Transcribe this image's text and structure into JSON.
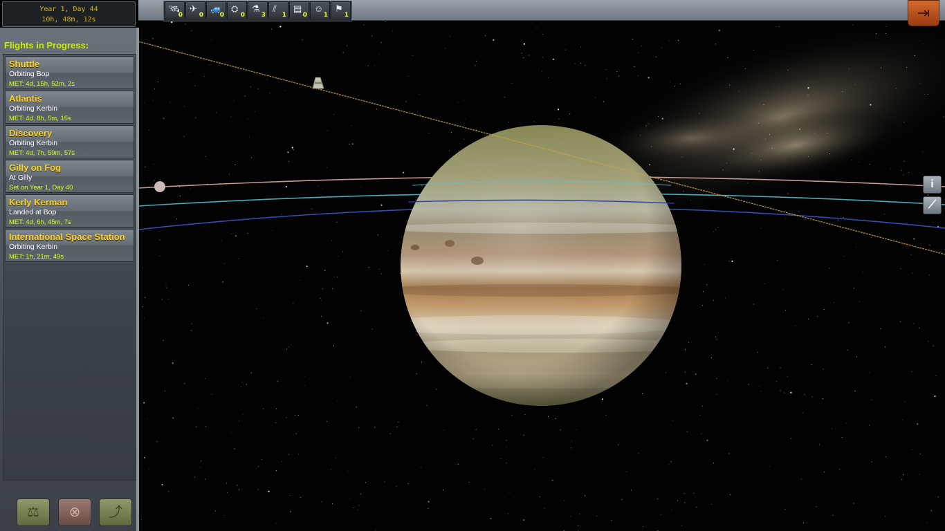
{
  "clock": {
    "date": "Year 1, Day 44",
    "time": "10h, 48m, 12s"
  },
  "filters": [
    {
      "icon": "probe-icon",
      "glyph": "🛰",
      "count": "0"
    },
    {
      "icon": "ship-icon",
      "glyph": "✈",
      "count": "0"
    },
    {
      "icon": "rover-icon",
      "glyph": "🚙",
      "count": "0"
    },
    {
      "icon": "lander-icon",
      "glyph": "⛭",
      "count": "0"
    },
    {
      "icon": "science-icon",
      "glyph": "⚗",
      "count": "3"
    },
    {
      "icon": "debris-icon",
      "glyph": "⫽",
      "count": "1"
    },
    {
      "icon": "base-icon",
      "glyph": "▤",
      "count": "0"
    },
    {
      "icon": "eva-icon",
      "glyph": "☺",
      "count": "1"
    },
    {
      "icon": "flag-icon",
      "glyph": "⚑",
      "count": "1"
    }
  ],
  "sidebar": {
    "title": "Flights in Progress:",
    "flights": [
      {
        "name": "Shuttle",
        "status": "Orbiting Bop",
        "met": "MET: 4d, 15h, 52m, 2s"
      },
      {
        "name": "Atlantis",
        "status": "Orbiting Kerbin",
        "met": "MET: 4d, 8h, 5m, 15s"
      },
      {
        "name": "Discovery",
        "status": "Orbiting Kerbin",
        "met": "MET: 4d, 7h, 59m, 57s"
      },
      {
        "name": "Gilly on Fog",
        "status": "At Gilly",
        "met": "Set on Year 1, Day 40"
      },
      {
        "name": "Kerly Kerman",
        "status": "Landed at Bop",
        "met": "MET: 4d, 6h, 45m, 7s"
      },
      {
        "name": "International Space Station",
        "status": "Orbiting Kerbin",
        "met": "MET: 1h, 21m, 49s"
      }
    ]
  },
  "buttons": {
    "edit": "⚖",
    "terminate": "⊗",
    "recover": "⤴"
  },
  "tools": {
    "info": "i",
    "orbit": "⟋"
  },
  "exit": "⇥",
  "colors": {
    "accent_yellow": "#ffd21e",
    "met_green": "#d8ff1a",
    "title_green": "#c9f000"
  }
}
